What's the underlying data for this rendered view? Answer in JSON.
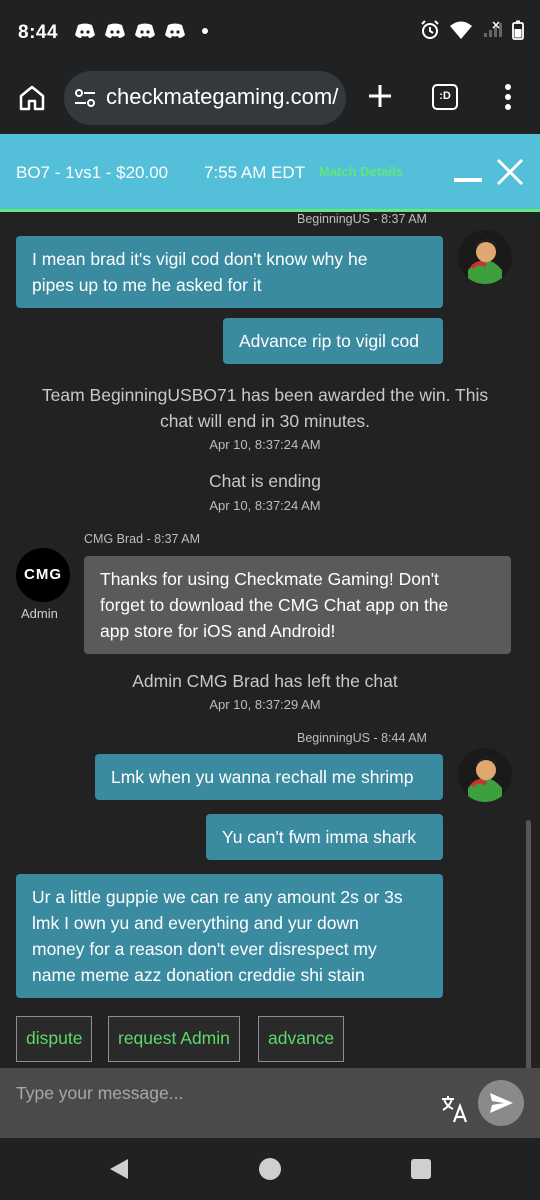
{
  "status_bar": {
    "time": "8:44"
  },
  "browser": {
    "url": "checkmategaming.com/",
    "tabs_label": ":D"
  },
  "match": {
    "title": "BO7 - 1vs1 - $20.00",
    "time": "7:55 AM EDT",
    "details_link": "Match Details"
  },
  "messages": {
    "m1_meta": "BeginningUS - 8:37 AM",
    "m1_line1": "I mean brad it's vigil cod don't know why he",
    "m1_line2": "pipes up to me he asked for it",
    "m2": "Advance rip to vigil cod",
    "sys1_line1": "Team BeginningUSBO71 has been awarded the win. This",
    "sys1_line2": "chat will end in 30 minutes.",
    "sys1_time": "Apr 10, 8:37:24 AM",
    "sys2": "Chat is ending",
    "sys2_time": "Apr 10, 8:37:24 AM",
    "admin_meta": "CMG Brad - 8:37 AM",
    "admin_avatar": "CMG",
    "admin_label": "Admin",
    "admin_line1": "Thanks for using Checkmate Gaming! Don't",
    "admin_line2": "forget to download the CMG Chat app on the",
    "admin_line3": "app store for iOS and Android!",
    "sys3": "Admin CMG Brad has left the chat",
    "sys3_time": "Apr 10, 8:37:29 AM",
    "m3_meta": "BeginningUS - 8:44 AM",
    "m3": "Lmk when yu wanna rechall me shrimp",
    "m4": "Yu can't fwm imma shark",
    "m5_line1": "Ur a little guppie we can re any amount 2s or 3s",
    "m5_line2": "lmk I own yu and everything and yur down",
    "m5_line3": "money for a reason don't ever disrespect my",
    "m5_line4": "name meme azz donation creddie shi stain"
  },
  "actions": {
    "dispute": "dispute",
    "request_admin": "request Admin",
    "advance": "advance"
  },
  "composer": {
    "placeholder": "Type your message..."
  },
  "colors": {
    "header": "#53bfd8",
    "accent_green": "#60ea79",
    "bubble_blue": "#3a8ba0",
    "bubble_grey": "#5a5a5a"
  }
}
